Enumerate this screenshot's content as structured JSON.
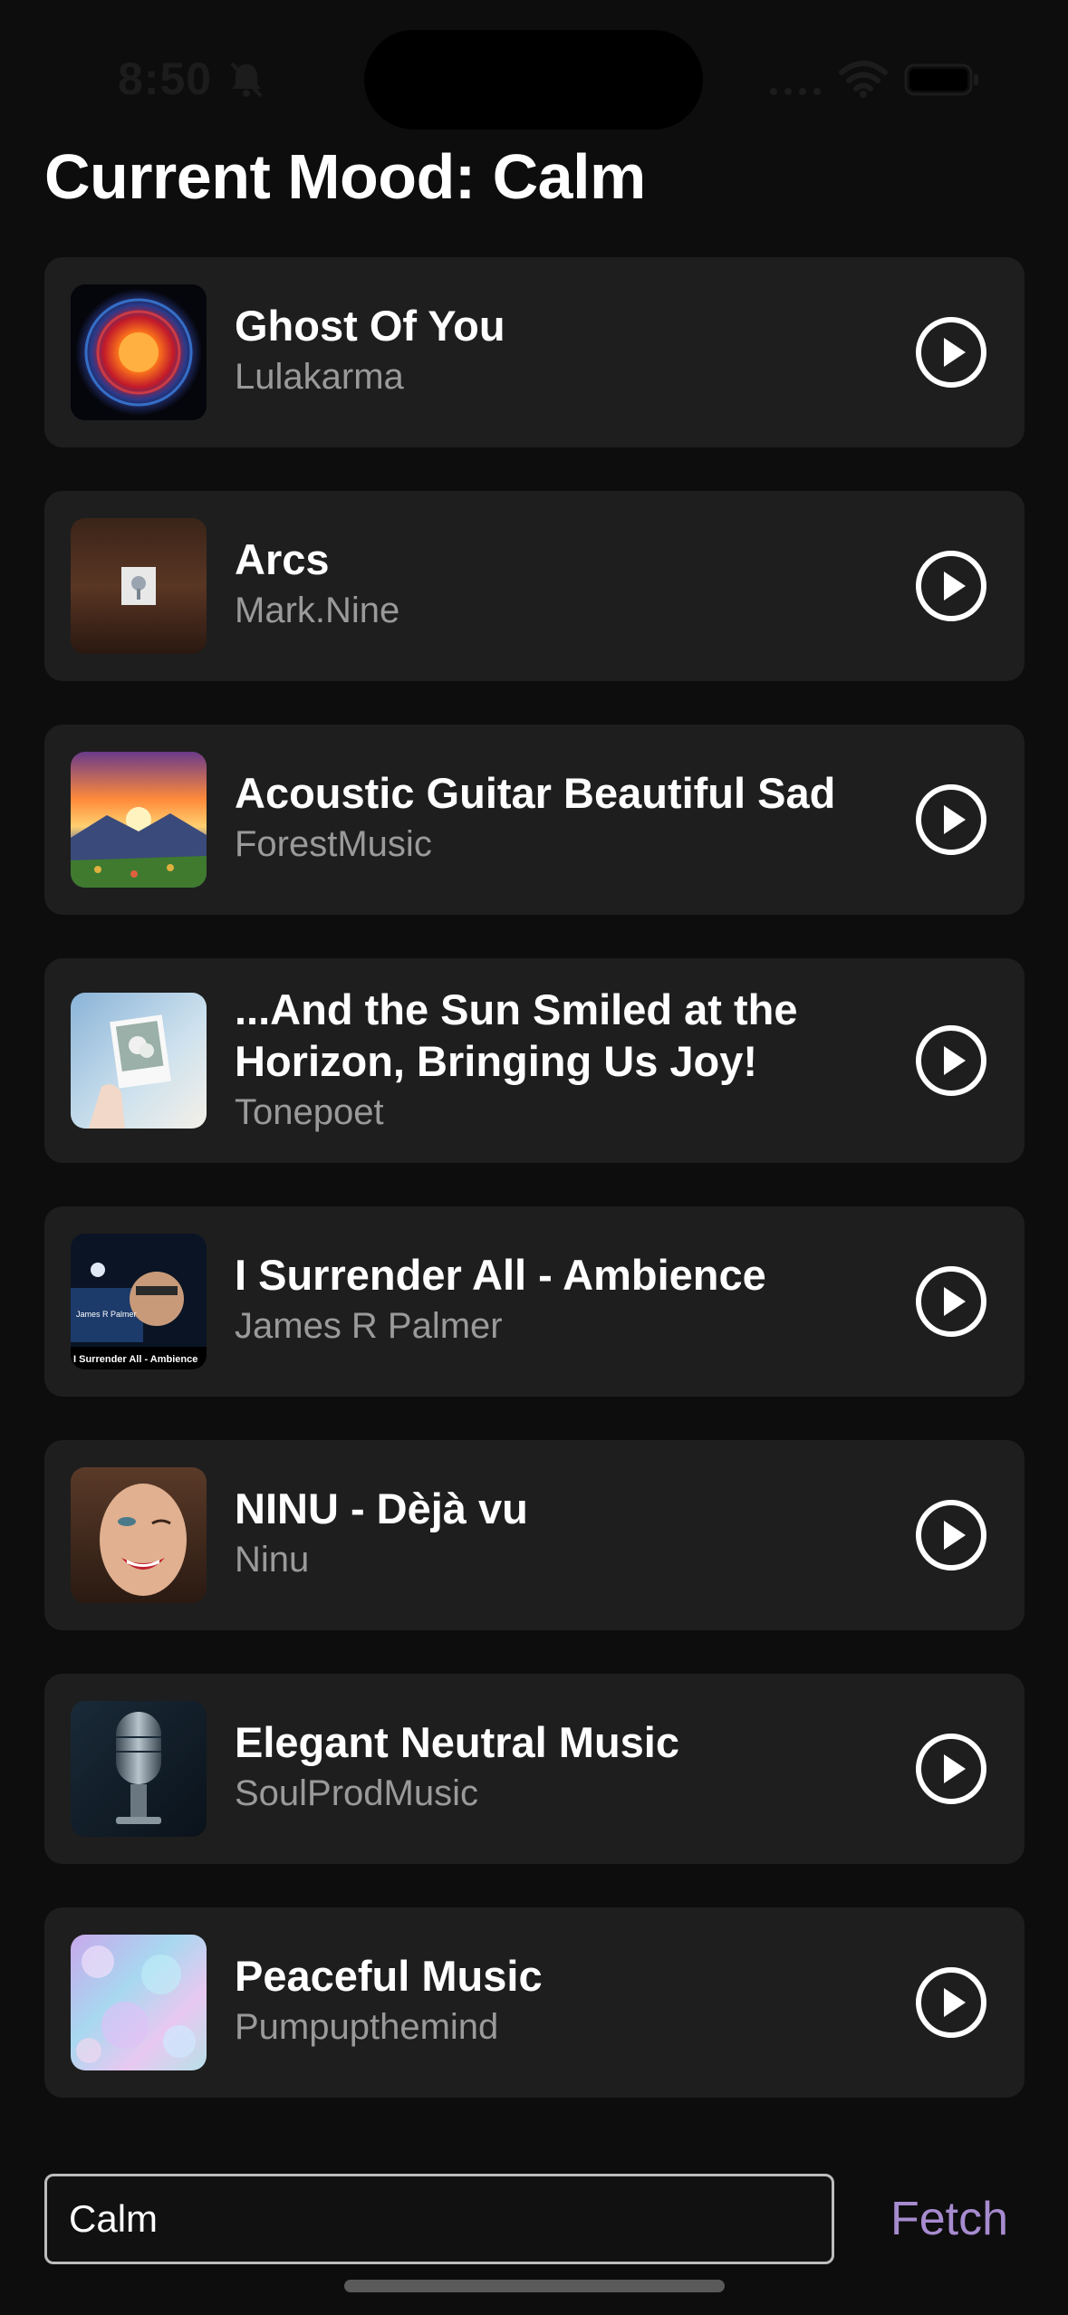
{
  "status_bar": {
    "time": "8:50"
  },
  "header": {
    "title": "Current Mood: Calm"
  },
  "songs": [
    {
      "title": "Ghost Of You",
      "artist": "Lulakarma"
    },
    {
      "title": "Arcs",
      "artist": "Mark.Nine"
    },
    {
      "title": "Acoustic Guitar Beautiful Sad",
      "artist": "ForestMusic"
    },
    {
      "title": "...And the Sun Smiled at the Horizon, Bringing Us Joy!",
      "artist": "Tonepoet"
    },
    {
      "title": "I Surrender All - Ambience",
      "artist": "James R Palmer"
    },
    {
      "title": "NINU - Dèjà vu",
      "artist": "Ninu"
    },
    {
      "title": "Elegant Neutral Music",
      "artist": "SoulProdMusic"
    },
    {
      "title": "Peaceful Music",
      "artist": "Pumpupthemind"
    }
  ],
  "thumbnail_labels": {
    "surrender": "I Surrender All - Ambience",
    "surrender_name": "James R Palmer"
  },
  "footer": {
    "input_value": "Calm",
    "fetch_label": "Fetch"
  },
  "icons": {
    "play": "play-circle-icon",
    "bell": "bell-slash-icon",
    "wifi": "wifi-icon",
    "battery": "battery-icon",
    "signal": "cellular-signal-icon"
  },
  "colors": {
    "background": "#0d0d0d",
    "card": "#1e1e1e",
    "artist_text": "#9a9a9a",
    "accent": "#a78bcf"
  }
}
